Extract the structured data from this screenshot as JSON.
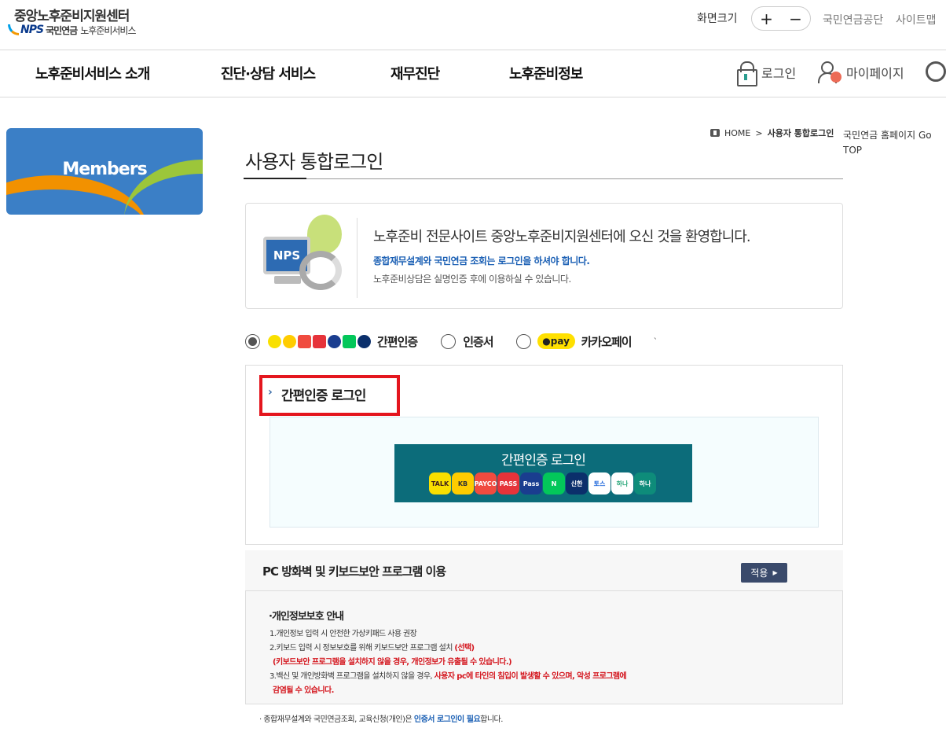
{
  "header": {
    "logo_title": "중앙노후준비지원센터",
    "logo_nps": "NPS",
    "logo_org": "국민연금",
    "logo_service": "노후준비서비스",
    "fontsize_label": "화면크기",
    "fontsize_plus": "+",
    "fontsize_minus": "−",
    "link_nps": "국민연금공단",
    "link_sitemap": "사이트맵"
  },
  "gnb": {
    "items": [
      "노후준비서비스 소개",
      "진단·상담 서비스",
      "재무진단",
      "노후준비정보"
    ],
    "login": "로그인",
    "mypage": "마이페이지"
  },
  "side": {
    "members": "Members"
  },
  "breadcrumb": {
    "home": "HOME",
    "sep": ">",
    "current": "사용자 통합로그인",
    "extra": "국민연금 홈페이지 Go TOP"
  },
  "page": {
    "title": "사용자 통합로그인"
  },
  "welcome": {
    "monitor": "NPS",
    "heading": "노후준비 전문사이트 중앙노후준비지원센터에 오신 것을 환영합니다.",
    "notice": "종합재무설계와 국민연금 조회는 로그인을 하셔야 합니다.",
    "sub": "노후준비상담은 실명인증 후에 이용하실 수 있습니다."
  },
  "login_options": {
    "simple": "간편인증",
    "cert": "인증서",
    "kakao_badge": "pay",
    "kakao": "카카오페이",
    "tick": "`"
  },
  "easy": {
    "heading": "간편인증 로그인",
    "button_label": "간편인증 로그인",
    "providers": [
      {
        "name": "TALK",
        "color": "#f9e000",
        "text": "#3c1e1e"
      },
      {
        "name": "KB",
        "color": "#ffcc00",
        "text": "#333333"
      },
      {
        "name": "PAYCO",
        "color": "#f04b3f",
        "text": "#ffffff"
      },
      {
        "name": "PASS",
        "color": "#e6333a",
        "text": "#ffffff"
      },
      {
        "name": "Pass",
        "color": "#1a3d8f",
        "text": "#ffffff"
      },
      {
        "name": "N",
        "color": "#03c75a",
        "text": "#ffffff"
      },
      {
        "name": "신한",
        "color": "#0b2f6b",
        "text": "#ffffff"
      },
      {
        "name": "토스",
        "color": "#ffffff",
        "text": "#1b64da"
      },
      {
        "name": "하나",
        "color": "#ffffff",
        "text": "#2aa77a"
      },
      {
        "name": "하나",
        "color": "#0e8c7a",
        "text": "#ffffff"
      }
    ]
  },
  "security": {
    "title": "PC 방화벽 및 키보드보안 프로그램 이용",
    "apply": "적용",
    "privacy_title": "·개인정보보호 안내",
    "line1": "1.개인정보 입력 시 안전한 가상키패드 사용 권장",
    "line2a": "2.키보드 입력 시 정보보호를 위해 키보드보안 프로그램 설치 ",
    "line2b": "(선택)",
    "line3": "(키보드보안 프로그램을 설치하지 않을 경우, 개인정보가 유출될 수 있습니다.)",
    "line4a": "3.백신 및 개인방화벽 프로그램을 설치하지 않을 경우, ",
    "line4b": "사용자 pc에 타인의 침입이 발생할 수 있으며, 악성 프로그램에",
    "line5": "감염될 수 있습니다."
  },
  "footnote": {
    "a": "· 종합재무설계와 국민연금조회, 교육신청(개인)은 ",
    "b": "인증서 로그인이 필요",
    "c": "합니다."
  },
  "colors": {
    "accent_teal": "#0c6c7a",
    "highlight_red": "#e4161e",
    "members_blue": "#3b7fc6"
  }
}
